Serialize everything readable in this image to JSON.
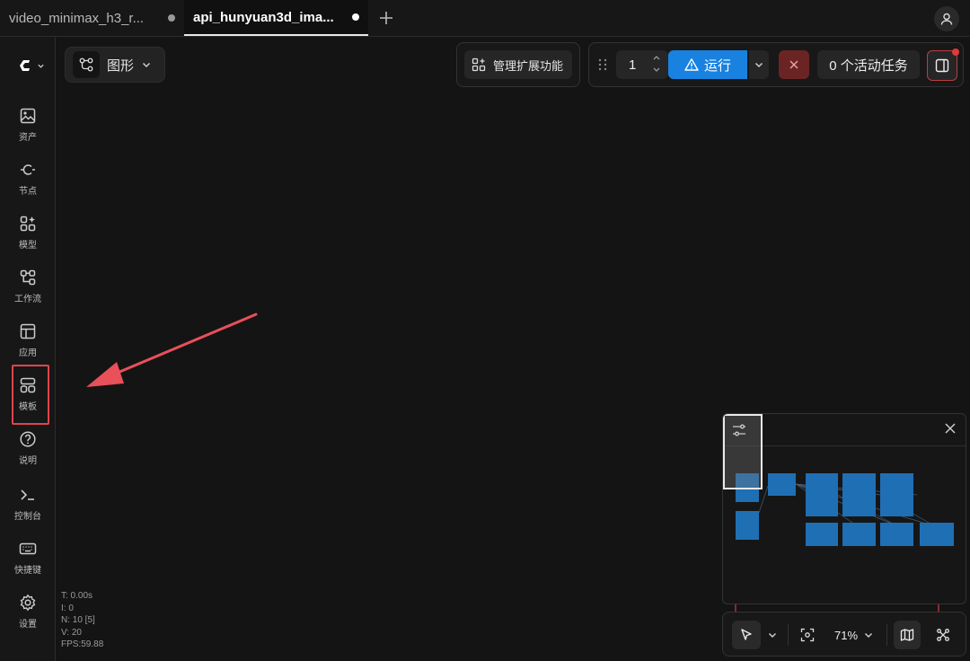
{
  "tabs": [
    {
      "label": "video_minimax_h3_r...",
      "active": false
    },
    {
      "label": "api_hunyuan3d_ima...",
      "active": true
    }
  ],
  "sidebar": {
    "items": [
      {
        "label": "资产",
        "icon": "image-icon"
      },
      {
        "label": "节点",
        "icon": "node-icon"
      },
      {
        "label": "模型",
        "icon": "model-icon"
      },
      {
        "label": "工作流",
        "icon": "workflow-icon"
      },
      {
        "label": "应用",
        "icon": "app-icon"
      },
      {
        "label": "模板",
        "icon": "template-icon"
      },
      {
        "label": "说明",
        "icon": "help-icon"
      },
      {
        "label": "控制台",
        "icon": "console-icon"
      },
      {
        "label": "快捷键",
        "icon": "keyboard-icon"
      },
      {
        "label": "设置",
        "icon": "settings-icon"
      }
    ]
  },
  "toolbar": {
    "view_label": "图形",
    "extensions_label": "管理扩展功能",
    "batch_count": "1",
    "run_label": "运行",
    "queue_label": "0 个活动任务"
  },
  "stats": {
    "t": "T: 0.00s",
    "i": "I: 0",
    "n": "N: 10 [5]",
    "v": "V: 20",
    "fps": "FPS:59.88"
  },
  "zoom": "71%",
  "colors": {
    "accent": "#1982e0",
    "stop": "#6b2424",
    "highlight": "#e0444c",
    "minimap_node": "#1f6fb5"
  }
}
